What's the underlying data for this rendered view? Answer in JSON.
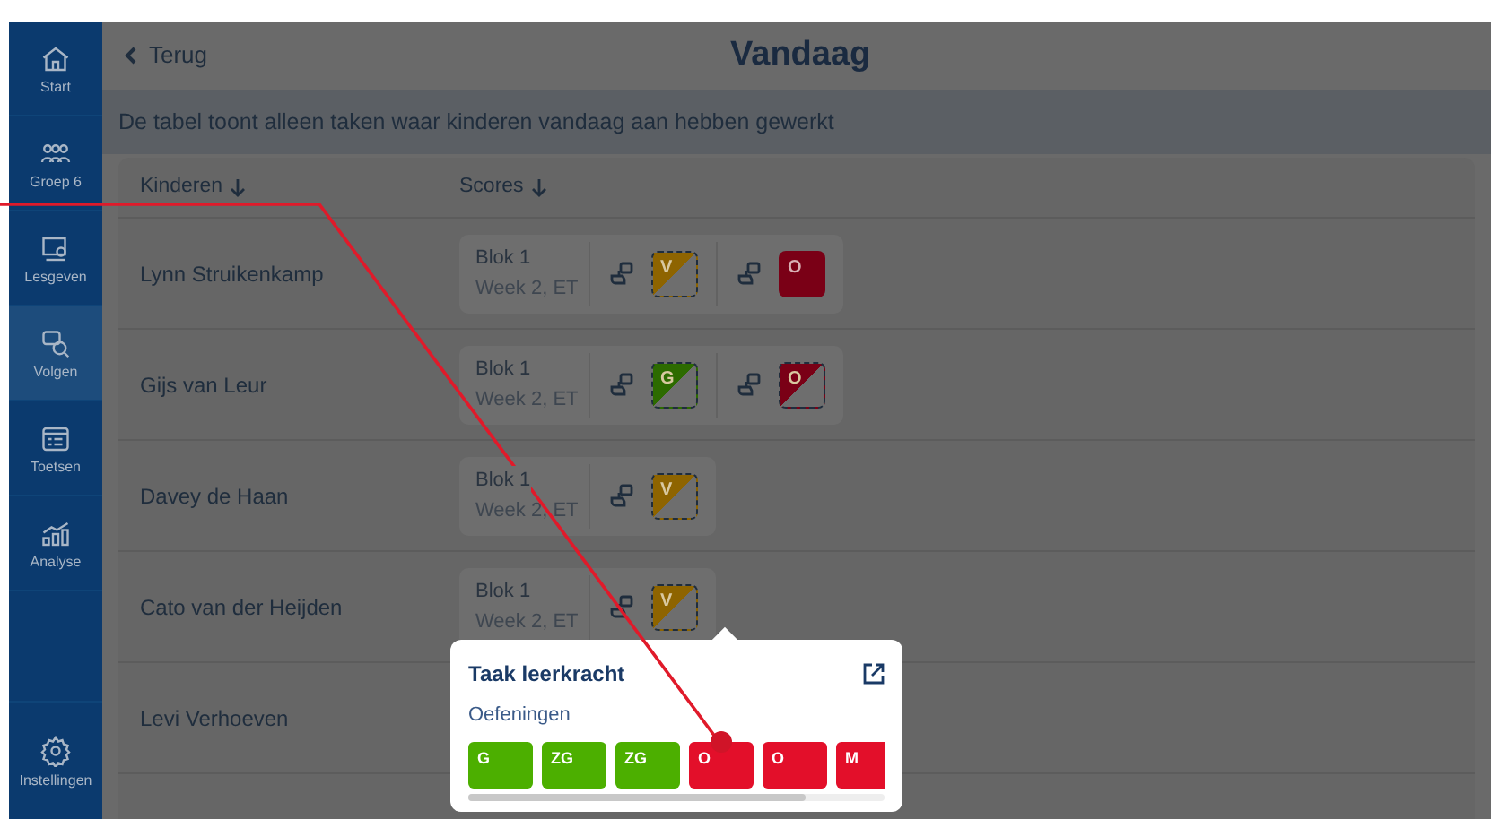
{
  "sidebar": {
    "items": [
      {
        "label": "Start",
        "selected": false
      },
      {
        "label": "Groep 6",
        "selected": false
      },
      {
        "label": "Lesgeven",
        "selected": false
      },
      {
        "label": "Volgen",
        "selected": true
      },
      {
        "label": "Toetsen",
        "selected": false
      },
      {
        "label": "Analyse",
        "selected": false
      }
    ],
    "footer": {
      "label": "Instellingen"
    }
  },
  "header": {
    "back": "Terug",
    "title": "Vandaag"
  },
  "info": "De tabel toont alleen taken waar kinderen vandaag aan hebben gewerkt",
  "table": {
    "columns": [
      "Kinderen",
      "Scores"
    ],
    "rows": [
      {
        "name": "Lynn Struikenkamp",
        "block": "Blok 1",
        "week": "Week 2, ET",
        "scores": [
          {
            "kind": "half",
            "letter": "V",
            "color": "#8e6400"
          },
          {
            "kind": "full",
            "letter": "O",
            "color": "#7a0016"
          }
        ]
      },
      {
        "name": "Gijs van Leur",
        "block": "Blok 1",
        "week": "Week 2, ET",
        "scores": [
          {
            "kind": "half",
            "letter": "G",
            "color": "#2d6b00"
          },
          {
            "kind": "half",
            "letter": "O",
            "color": "#7a0016"
          }
        ]
      },
      {
        "name": "Davey de Haan",
        "block": "Blok 1",
        "week": "Week 2, ET",
        "scores": [
          {
            "kind": "half",
            "letter": "V",
            "color": "#8e6400"
          }
        ]
      },
      {
        "name": "Cato van der Heijden",
        "block": "Blok 1",
        "week": "Week 2, ET",
        "scores": [
          {
            "kind": "half",
            "letter": "V",
            "color": "#8e6400"
          }
        ]
      },
      {
        "name": "Levi Verhoeven",
        "scores": []
      }
    ]
  },
  "popup": {
    "title": "Taak leerkracht",
    "subtitle": "Oefeningen",
    "tiles": [
      {
        "letter": "G",
        "color": "#4caf00"
      },
      {
        "letter": "ZG",
        "color": "#4caf00"
      },
      {
        "letter": "ZG",
        "color": "#4caf00"
      },
      {
        "letter": "O",
        "color": "#e30f2a"
      },
      {
        "letter": "O",
        "color": "#e30f2a"
      },
      {
        "letter": "M",
        "color": "#e30f2a"
      }
    ]
  }
}
